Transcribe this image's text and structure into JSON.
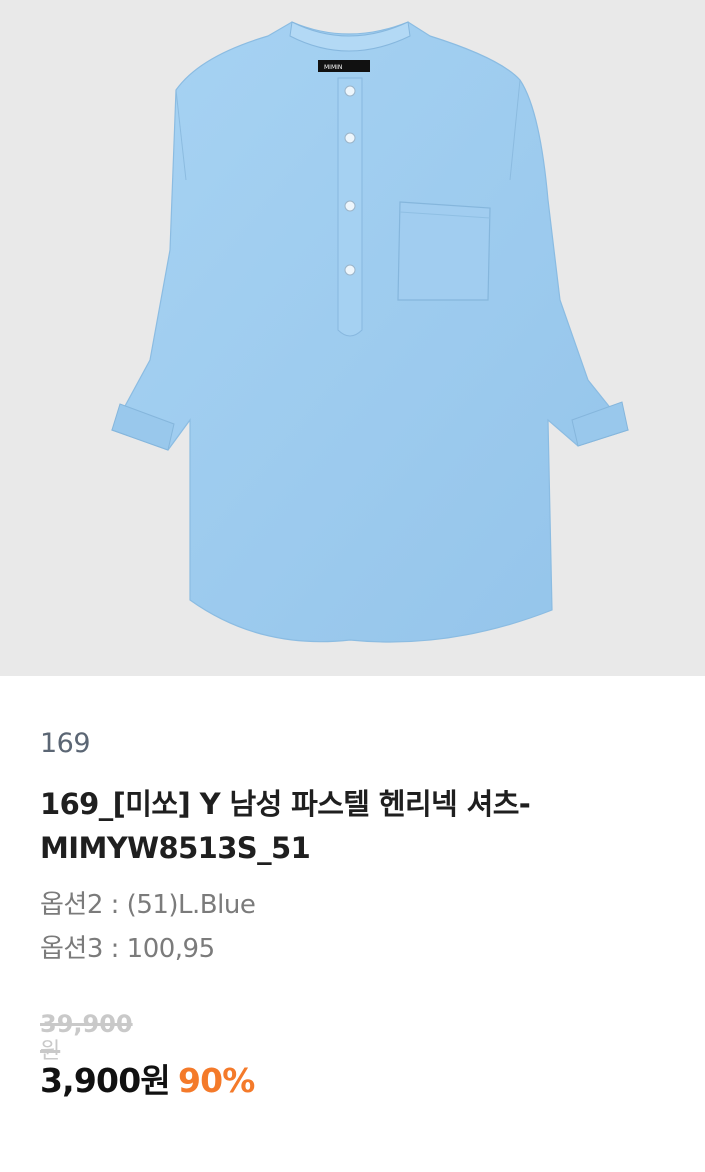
{
  "product": {
    "brand": "169",
    "title": "169_[미쏘] Y 남성 파스텔 헨리넥 셔츠-MIMYW8513S_51",
    "option2": "옵션2 : (51)L.Blue",
    "option3": "옵션3 : 100,95",
    "original_price": "39,900",
    "original_price_unit": "원",
    "sale_price": "3,900원",
    "discount": "90%"
  },
  "colors": {
    "shirt": "#9fcdf0",
    "image_bg": "#e9e9e9",
    "discount": "#f47a2a",
    "brand": "#5b6674"
  },
  "image": {
    "label_text": "MIMIN"
  }
}
